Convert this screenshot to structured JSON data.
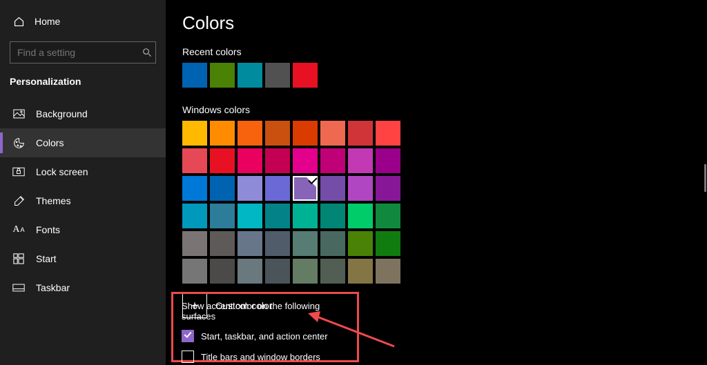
{
  "sidebar": {
    "home": "Home",
    "search_placeholder": "Find a setting",
    "category": "Personalization",
    "items": [
      {
        "label": "Background",
        "icon": "background-icon"
      },
      {
        "label": "Colors",
        "icon": "colors-icon"
      },
      {
        "label": "Lock screen",
        "icon": "lock-screen-icon"
      },
      {
        "label": "Themes",
        "icon": "themes-icon"
      },
      {
        "label": "Fonts",
        "icon": "fonts-icon"
      },
      {
        "label": "Start",
        "icon": "start-icon"
      },
      {
        "label": "Taskbar",
        "icon": "taskbar-icon"
      }
    ],
    "selected_index": 1
  },
  "page": {
    "title": "Colors",
    "recent_label": "Recent colors",
    "recent": [
      "#0063B1",
      "#498205",
      "#008C9E",
      "#515151",
      "#E81123"
    ],
    "grid_label": "Windows colors",
    "grid": [
      [
        "#FFB900",
        "#FF8C00",
        "#F7630C",
        "#CA5010",
        "#DA3B01",
        "#EF6950",
        "#D13438",
        "#FF4343"
      ],
      [
        "#E74856",
        "#E81123",
        "#EA005E",
        "#C30052",
        "#E3008C",
        "#BF0077",
        "#C239B3",
        "#9A0089"
      ],
      [
        "#0078D7",
        "#0063B1",
        "#8E8CD8",
        "#6B69D6",
        "#8764B8",
        "#744DA9",
        "#B146C2",
        "#881798"
      ],
      [
        "#0099BC",
        "#2D7D9A",
        "#00B7C3",
        "#038387",
        "#00B294",
        "#018574",
        "#00CC6A",
        "#10893E"
      ],
      [
        "#7A7574",
        "#5D5A58",
        "#68768A",
        "#515C6B",
        "#567C73",
        "#486860",
        "#498205",
        "#107C10"
      ],
      [
        "#767676",
        "#4C4A48",
        "#69797E",
        "#4A5459",
        "#647C64",
        "#525E54",
        "#847545",
        "#7E735F"
      ]
    ],
    "selected": {
      "row": 2,
      "col": 4
    },
    "custom_label": "Custom color",
    "accent_section": {
      "title": "Show accent color on the following surfaces",
      "options": [
        {
          "label": "Start, taskbar, and action center",
          "checked": true
        },
        {
          "label": "Title bars and window borders",
          "checked": false
        }
      ]
    }
  },
  "colors": {
    "accent": "#8e66cc",
    "annotation": "#EF4A4C"
  }
}
